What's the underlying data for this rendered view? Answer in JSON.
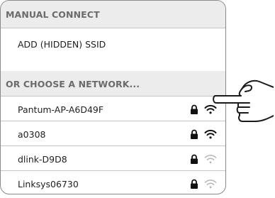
{
  "manual_connect": {
    "header": "MANUAL CONNECT",
    "add_hidden_ssid": "ADD (HIDDEN) SSID"
  },
  "choose_network": {
    "header": "OR CHOOSE A NETWORK...",
    "networks": [
      {
        "ssid": "Pantum-AP-A6D49F",
        "secured": true,
        "signal": "strong",
        "icons": [
          "lock-icon",
          "wifi-icon"
        ]
      },
      {
        "ssid": "a0308",
        "secured": true,
        "signal": "strong",
        "icons": [
          "lock-icon",
          "wifi-icon"
        ]
      },
      {
        "ssid": "dlink-D9D8",
        "secured": true,
        "signal": "weak",
        "icons": [
          "lock-icon",
          "wifi-icon"
        ]
      },
      {
        "ssid": "Linksys06730",
        "secured": true,
        "signal": "weak",
        "icons": [
          "lock-icon",
          "wifi-icon"
        ]
      }
    ]
  },
  "colors": {
    "header_bg": "#ececec",
    "header_text": "#6b6b6b",
    "wifi_strong": "#111111",
    "wifi_weak": "#b5b5b5"
  },
  "decorations": [
    "pointing-hand-icon"
  ]
}
